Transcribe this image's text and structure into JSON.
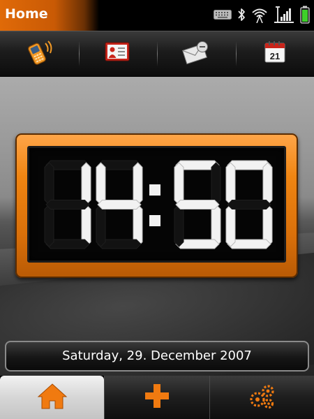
{
  "statusbar": {
    "title": "Home",
    "icons": [
      "keyboard-icon",
      "bluetooth-icon",
      "wifi-icon",
      "signal-icon",
      "battery-icon"
    ]
  },
  "toolbar": {
    "items": [
      {
        "name": "phone-icon"
      },
      {
        "name": "contacts-icon"
      },
      {
        "name": "messages-icon"
      },
      {
        "name": "calendar-icon",
        "badge": "21"
      }
    ]
  },
  "clock": {
    "time": "14:50",
    "frame_color": "#f08512",
    "digit_color": "#f2f2f2"
  },
  "date": {
    "text": "Saturday, 29. December 2007"
  },
  "bottomnav": {
    "items": [
      {
        "name": "home-icon",
        "active": true
      },
      {
        "name": "add-icon",
        "active": false
      },
      {
        "name": "settings-icon",
        "active": false
      }
    ],
    "accent": "#f07a10"
  }
}
